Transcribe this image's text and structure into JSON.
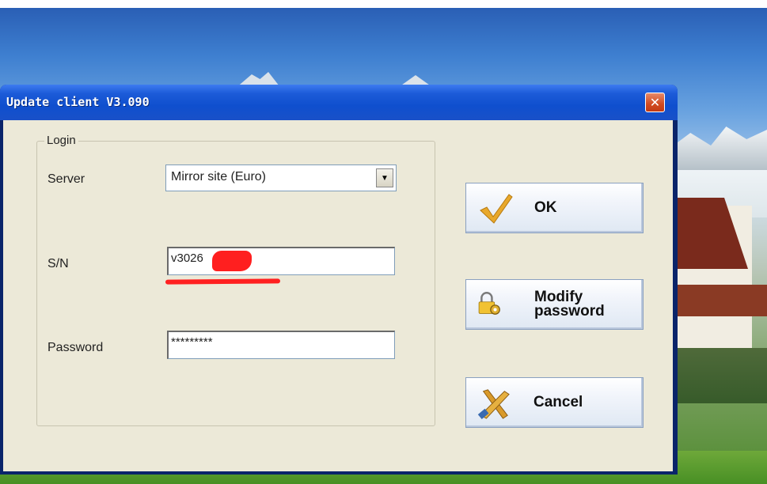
{
  "dialog": {
    "title": "Update client V3.090",
    "close_glyph": "✕"
  },
  "login": {
    "group_label": "Login",
    "server": {
      "label": "Server",
      "selected": "Mirror site (Euro)"
    },
    "sn": {
      "label": "S/N",
      "value": "v3026"
    },
    "password": {
      "label": "Password",
      "value": "*********"
    }
  },
  "buttons": {
    "ok": "OK",
    "modify_line1": "Modify",
    "modify_line2": "password",
    "cancel": "Cancel"
  },
  "icons": {
    "ok": "checkmark-icon",
    "modify": "lock-gear-icon",
    "cancel": "cross-tools-icon"
  },
  "colors": {
    "titlebar": "#0f4fce",
    "dialog_bg": "#ece9d8",
    "redaction": "#ff1f1f"
  }
}
